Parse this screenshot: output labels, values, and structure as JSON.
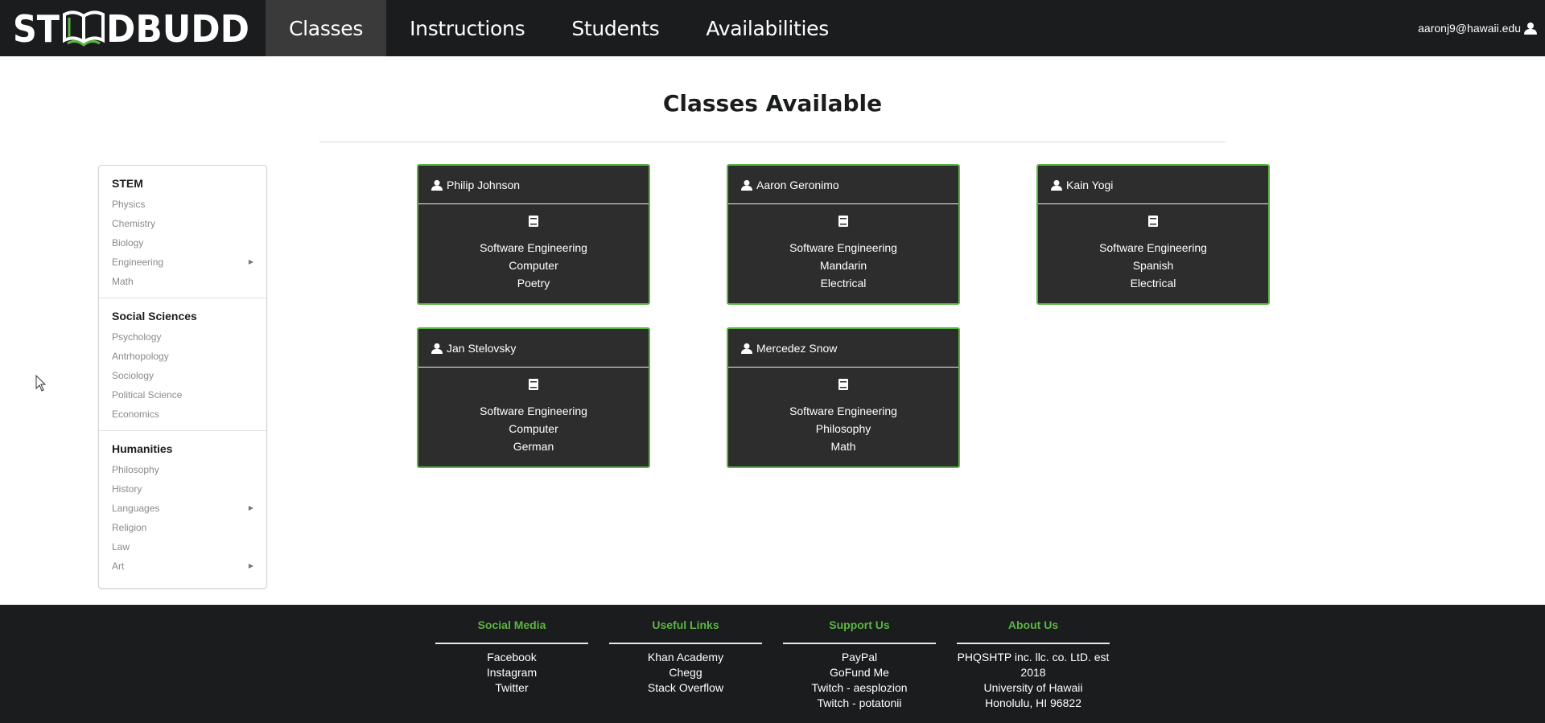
{
  "brand": {
    "logo_text": "STUDBUDD",
    "accent": "#5bb543"
  },
  "nav": {
    "items": [
      {
        "label": "Classes",
        "active": true
      },
      {
        "label": "Instructions",
        "active": false
      },
      {
        "label": "Students",
        "active": false
      },
      {
        "label": "Availabilities",
        "active": false
      }
    ],
    "user_email": "aaronj9@hawaii.edu",
    "user_icon": "user-icon"
  },
  "main": {
    "title": "Classes Available"
  },
  "sidebar": {
    "categories": [
      {
        "title": "STEM",
        "items": [
          {
            "label": "Physics",
            "submenu": false
          },
          {
            "label": "Chemistry",
            "submenu": false
          },
          {
            "label": "Biology",
            "submenu": false
          },
          {
            "label": "Engineering",
            "submenu": true
          },
          {
            "label": "Math",
            "submenu": false
          }
        ]
      },
      {
        "title": "Social Sciences",
        "items": [
          {
            "label": "Psychology",
            "submenu": false
          },
          {
            "label": "Antrhopology",
            "submenu": false
          },
          {
            "label": "Sociology",
            "submenu": false
          },
          {
            "label": "Political Science",
            "submenu": false
          },
          {
            "label": "Economics",
            "submenu": false
          }
        ]
      },
      {
        "title": "Humanities",
        "items": [
          {
            "label": "Philosophy",
            "submenu": false
          },
          {
            "label": "History",
            "submenu": false
          },
          {
            "label": "Languages",
            "submenu": true
          },
          {
            "label": "Religion",
            "submenu": false
          },
          {
            "label": "Law",
            "submenu": false
          },
          {
            "label": "Art",
            "submenu": true
          }
        ]
      }
    ]
  },
  "cards": [
    {
      "name": "Philip Johnson",
      "subjects": [
        "Software Engineering",
        "Computer",
        "Poetry"
      ]
    },
    {
      "name": "Aaron Geronimo",
      "subjects": [
        "Software Engineering",
        "Mandarin",
        "Electrical"
      ]
    },
    {
      "name": "Kain Yogi",
      "subjects": [
        "Software Engineering",
        "Spanish",
        "Electrical"
      ]
    },
    {
      "name": "Jan Stelovsky",
      "subjects": [
        "Software Engineering",
        "Computer",
        "German"
      ]
    },
    {
      "name": "Mercedez Snow",
      "subjects": [
        "Software Engineering",
        "Philosophy",
        "Math"
      ]
    }
  ],
  "footer": {
    "columns": [
      {
        "title": "Social Media",
        "links": [
          "Facebook",
          "Instagram",
          "Twitter"
        ]
      },
      {
        "title": "Useful Links",
        "links": [
          "Khan Academy",
          "Chegg",
          "Stack Overflow"
        ]
      },
      {
        "title": "Support Us",
        "links": [
          "PayPal",
          "GoFund Me",
          "Twitch - aesplozion",
          "Twitch - potatonii"
        ]
      },
      {
        "title": "About Us",
        "text": [
          "PHQSHTP inc. llc. co. LtD. est",
          "2018",
          "University of Hawaii",
          "Honolulu, HI 96822"
        ]
      }
    ]
  }
}
